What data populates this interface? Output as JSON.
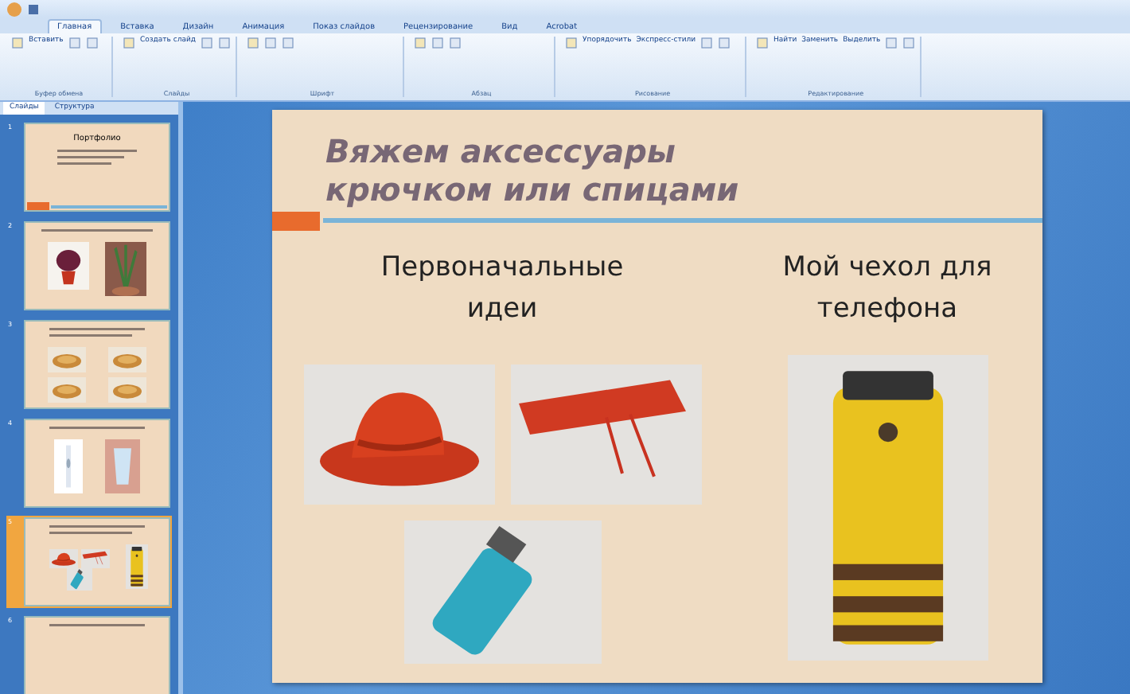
{
  "ribbon": {
    "tabs": [
      {
        "label": "Главная",
        "selected": true
      },
      {
        "label": "Вставка",
        "selected": false
      },
      {
        "label": "Дизайн",
        "selected": false
      },
      {
        "label": "Анимация",
        "selected": false
      },
      {
        "label": "Показ слайдов",
        "selected": false
      },
      {
        "label": "Рецензирование",
        "selected": false
      },
      {
        "label": "Вид",
        "selected": false
      },
      {
        "label": "Acrobat",
        "selected": false
      }
    ],
    "groups": [
      {
        "label": "Буфер обмена",
        "buttons": [
          "Вставить"
        ]
      },
      {
        "label": "Слайды",
        "buttons": [
          "Создать слайд"
        ]
      },
      {
        "label": "Шрифт"
      },
      {
        "label": "Абзац"
      },
      {
        "label": "Рисование",
        "buttons": [
          "Упорядочить",
          "Экспресс-стили"
        ]
      },
      {
        "label": "Редактирование",
        "buttons": [
          "Найти",
          "Заменить",
          "Выделить"
        ]
      }
    ]
  },
  "side_panel": {
    "tabs": [
      {
        "label": "Слайды",
        "selected": true
      },
      {
        "label": "Структура",
        "selected": false
      }
    ],
    "slides": [
      {
        "number": "1",
        "kind": "title",
        "title": "Портфолио",
        "selected": false
      },
      {
        "number": "2",
        "kind": "plants",
        "selected": false
      },
      {
        "number": "3",
        "kind": "dishes",
        "selected": false
      },
      {
        "number": "4",
        "kind": "patterns",
        "selected": false
      },
      {
        "number": "5",
        "kind": "knitting",
        "selected": true
      },
      {
        "number": "6",
        "kind": "partial",
        "selected": false
      }
    ]
  },
  "slide": {
    "title": "Вяжем аксессуары крючком или спицами",
    "left_heading": "Первоначальные идеи",
    "right_heading": "Мой чехол для телефона"
  }
}
